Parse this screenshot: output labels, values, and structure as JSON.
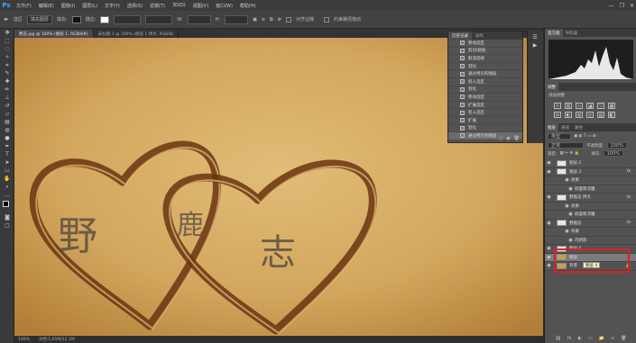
{
  "app": {
    "logo": "Ps"
  },
  "menubar": {
    "items": [
      "文件(F)",
      "编辑(E)",
      "图像(I)",
      "图层(L)",
      "文字(Y)",
      "选择(S)",
      "滤镜(T)",
      "3D(D)",
      "视图(V)",
      "窗口(W)",
      "帮助(H)"
    ],
    "window_controls": [
      "—",
      "❐",
      "✕"
    ]
  },
  "options": {
    "mode_label": "选区",
    "fill_label": "填充图层",
    "fill_text": "填充:",
    "stroke_text": "描边:",
    "align_edges": "对齐边缘",
    "constrain_path": "约束路径拖动"
  },
  "tabs": [
    {
      "label": "野志.jpg @ 100% (图层 1, RGB/8#)",
      "active": true
    },
    {
      "label": "未标题-1 @ 100% (图层 1 拷贝, RGB/8)",
      "active": false
    }
  ],
  "canvas": {
    "char1": "野",
    "char2": "鹿",
    "char3": "志",
    "sand_color": "#d9aa5c",
    "groove_color": "#6b3410"
  },
  "status": {
    "zoom": "100%",
    "doc": "文档:1.65M/22.1M"
  },
  "history_panel": {
    "tab_history": "历史记录",
    "tab_actions": "动作",
    "items": [
      "移动选区",
      "剪切/粘贴",
      "取消选择",
      "羽化",
      "通过拷贝的图层",
      "剪入选区",
      "羽化",
      "移动选区",
      "扩展选区",
      "剪入选区",
      "扩展",
      "羽化",
      "通过拷贝的图层"
    ],
    "selected_index": 12
  },
  "right_panel": {
    "tab_histogram": "直方图",
    "tab_info": "导航器",
    "adjust_tab": "调整",
    "adjust_subtitle": "添加调整",
    "layers_tab": "图层",
    "channels_tab": "通道",
    "paths_tab": "路径",
    "kind_label": "类型",
    "blend_mode": "正常",
    "opacity_label": "不透明度:",
    "opacity_value": "100%",
    "lock_label": "锁定:",
    "fill_label": "填充:",
    "fill_value": "100%",
    "layers": [
      {
        "name": "图层 2",
        "type": "layer",
        "fx": false
      },
      {
        "name": "图层 3",
        "type": "layer",
        "fx": true
      },
      {
        "name": "效果",
        "type": "effect-head"
      },
      {
        "name": "斜面和浮雕",
        "type": "effect"
      },
      {
        "name": "野鹿志 拷贝",
        "type": "layer",
        "fx": true
      },
      {
        "name": "效果",
        "type": "effect-head"
      },
      {
        "name": "斜面和浮雕",
        "type": "effect"
      },
      {
        "name": "野鹿志",
        "type": "layer",
        "fx": true
      },
      {
        "name": "效果",
        "type": "effect-head"
      },
      {
        "name": "内阴影",
        "type": "effect"
      },
      {
        "name": "图层 4",
        "type": "layer",
        "fx": false
      },
      {
        "name": "图层",
        "type": "layer-sand",
        "fx": false,
        "selected": true
      },
      {
        "name": "背景",
        "type": "layer-bg",
        "fx": false
      }
    ],
    "tooltip": "图层 4",
    "bottom_icons": [
      "⛓",
      "fx",
      "◐",
      "▭",
      "📁",
      "+",
      "🗑"
    ]
  }
}
